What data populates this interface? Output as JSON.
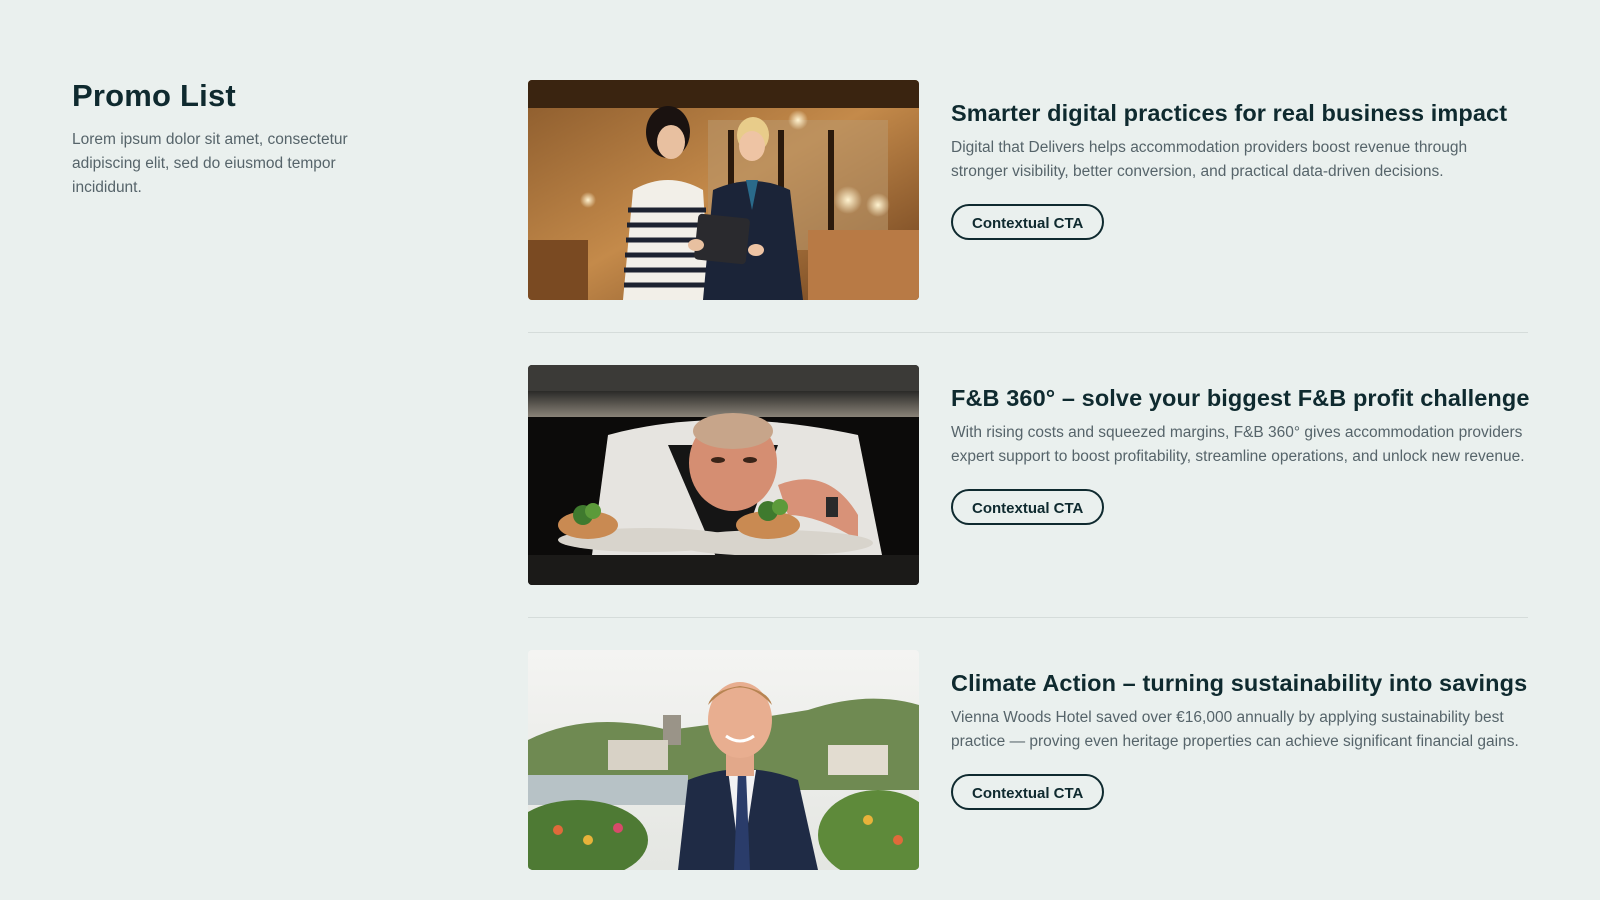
{
  "intro": {
    "title": "Promo List",
    "description": "Lorem ipsum dolor sit amet, consectetur adipiscing elit, sed do eiusmod tempor incididunt."
  },
  "promos": [
    {
      "title": "Smarter digital practices for real business impact",
      "description": "Digital that Delivers helps accommodation providers boost revenue through stronger visibility, better conversion, and practical data-driven decisions.",
      "cta": "Contextual CTA"
    },
    {
      "title": "F&B 360° – solve your biggest F&B profit challenge",
      "description": "With rising costs and squeezed margins, F&B 360° gives accommodation providers expert support to boost profitability, streamline operations, and unlock new revenue.",
      "cta": "Contextual CTA"
    },
    {
      "title": "Climate Action – turning sustainability into savings",
      "description": "Vienna Woods Hotel saved over €16,000 annually by applying sustainability best practice — proving even heritage properties can achieve significant financial gains.",
      "cta": "Contextual CTA"
    }
  ],
  "colors": {
    "background": "#eaf0ee",
    "heading": "#0f2a2f",
    "body_text": "#56646a",
    "divider": "#d5dcda"
  }
}
